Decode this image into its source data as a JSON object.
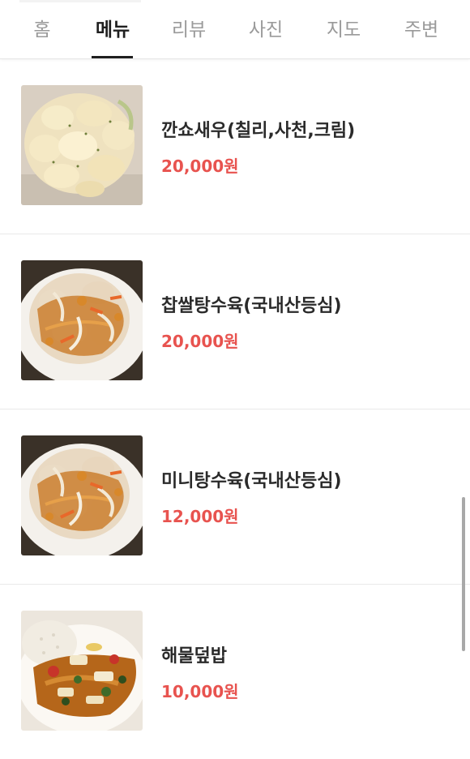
{
  "tabs": [
    {
      "label": "홈",
      "active": false
    },
    {
      "label": "메뉴",
      "active": true
    },
    {
      "label": "리뷰",
      "active": false
    },
    {
      "label": "사진",
      "active": false
    },
    {
      "label": "지도",
      "active": false
    },
    {
      "label": "주변",
      "active": false
    }
  ],
  "menu": {
    "items": [
      {
        "name": "깐쇼새우(칠리,사천,크림)",
        "price": "20,000원",
        "image_icon": "cream-shrimp-photo"
      },
      {
        "name": "찹쌀탕수육(국내산등심)",
        "price": "20,000원",
        "image_icon": "sweet-sour-pork-photo"
      },
      {
        "name": "미니탕수육(국내산등심)",
        "price": "12,000원",
        "image_icon": "sweet-sour-pork-photo"
      },
      {
        "name": "해물덮밥",
        "price": "10,000원",
        "image_icon": "seafood-rice-photo"
      }
    ]
  },
  "colors": {
    "price": "#e8534f",
    "active_tab": "#1f1f1f",
    "inactive_tab": "#9a9a9a"
  }
}
